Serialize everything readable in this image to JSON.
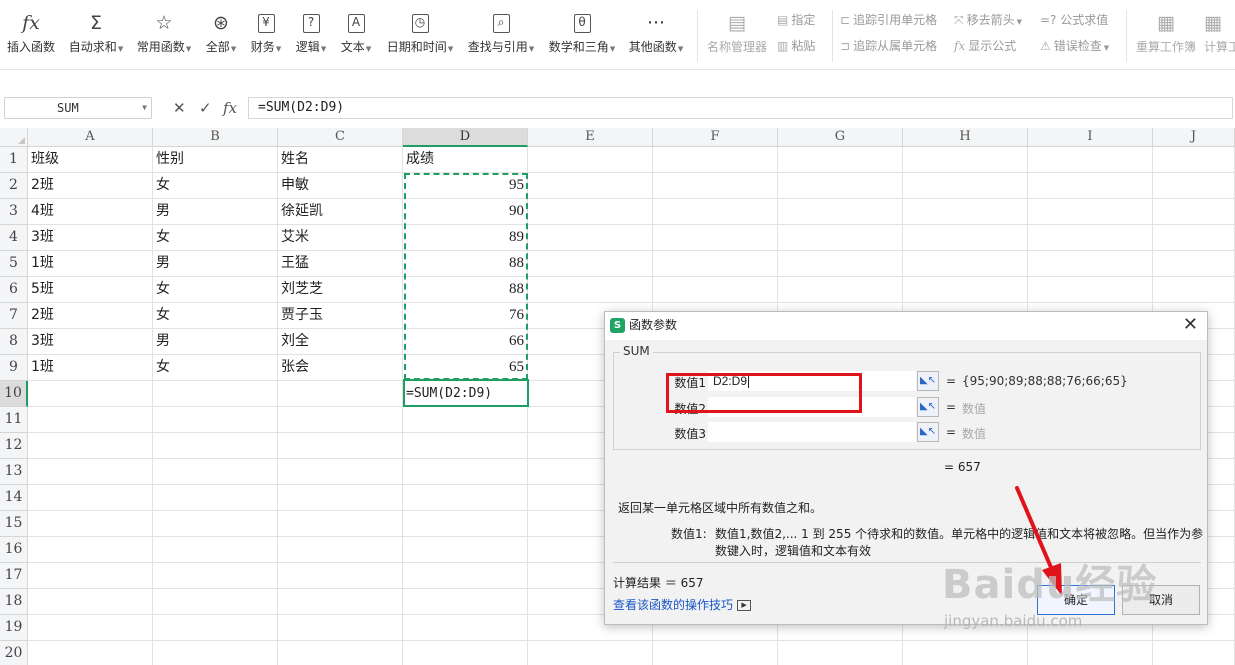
{
  "ribbon": {
    "items": [
      {
        "icon": "fx-icon",
        "glyph": "fx",
        "label": "插入函数",
        "dropdown": false
      },
      {
        "icon": "sigma-icon",
        "glyph": "Σ",
        "label": "自动求和",
        "dropdown": true
      },
      {
        "icon": "star-icon",
        "glyph": "☆",
        "label": "常用函数",
        "dropdown": true
      },
      {
        "icon": "asterisk-icon",
        "glyph": "⊛",
        "label": "全部",
        "dropdown": true
      },
      {
        "icon": "yen-icon",
        "glyph": "¥",
        "label": "财务",
        "dropdown": true
      },
      {
        "icon": "question-icon",
        "glyph": "?",
        "label": "逻辑",
        "dropdown": true
      },
      {
        "icon": "text-icon",
        "glyph": "A",
        "label": "文本",
        "dropdown": true
      },
      {
        "icon": "clock-icon",
        "glyph": "◷",
        "label": "日期和时间",
        "dropdown": true
      },
      {
        "icon": "lookup-icon",
        "glyph": "⌕",
        "label": "查找与引用",
        "dropdown": true
      },
      {
        "icon": "math-icon",
        "glyph": "θ",
        "label": "数学和三角",
        "dropdown": true
      },
      {
        "icon": "more-icon",
        "glyph": "···",
        "label": "其他函数",
        "dropdown": true
      },
      {
        "icon": "name-manager-icon",
        "glyph": "▤",
        "label": "名称管理器",
        "dropdown": false
      },
      {
        "icon": "recalc-workbook-icon",
        "glyph": "▦",
        "label": "重算工作簿",
        "dropdown": false
      },
      {
        "icon": "calc-sheet-icon",
        "glyph": "▦",
        "label": "计算工",
        "dropdown": false
      }
    ],
    "small": {
      "specify": "指定",
      "paste": "粘贴",
      "trace_precedents": "追踪引用单元格",
      "trace_dependents": "追踪从属单元格",
      "remove_arrows": "移去箭头",
      "show_formulas": "显示公式",
      "formula_eval": "=? 公式求值",
      "error_check": "错误检查"
    }
  },
  "formula_bar": {
    "name_box": "SUM",
    "cancel_glyph": "✕",
    "confirm_glyph": "✓",
    "fx_glyph": "fx",
    "content": "=SUM(D2:D9)"
  },
  "grid": {
    "columns": [
      "A",
      "B",
      "C",
      "D",
      "E",
      "F",
      "G",
      "H",
      "I",
      "J"
    ],
    "rows": [
      "1",
      "2",
      "3",
      "4",
      "5",
      "6",
      "7",
      "8",
      "9",
      "10",
      "11",
      "12",
      "13",
      "14",
      "15",
      "16",
      "17",
      "18",
      "19",
      "20"
    ],
    "data": [
      [
        "班级",
        "性别",
        "姓名",
        "成绩"
      ],
      [
        "2班",
        "女",
        "申敏",
        "95"
      ],
      [
        "4班",
        "男",
        "徐延凯",
        "90"
      ],
      [
        "3班",
        "女",
        "艾米",
        "89"
      ],
      [
        "1班",
        "男",
        "王猛",
        "88"
      ],
      [
        "5班",
        "女",
        "刘芝芝",
        "88"
      ],
      [
        "2班",
        "女",
        "贾子玉",
        "76"
      ],
      [
        "3班",
        "男",
        "刘全",
        "66"
      ],
      [
        "1班",
        "女",
        "张会",
        "65"
      ],
      [
        "",
        "",
        "",
        "=SUM(D2:D9)"
      ]
    ]
  },
  "dialog": {
    "title": "函数参数",
    "icon_letter": "S",
    "close_glyph": "✕",
    "function_name": "SUM",
    "args": [
      {
        "label": "数值1",
        "value": "D2:D9",
        "result": "{95;90;89;88;88;76;66;65}"
      },
      {
        "label": "数值2",
        "value": "",
        "result": "数值"
      },
      {
        "label": "数值3",
        "value": "",
        "result": "数值"
      }
    ],
    "eq": "=",
    "total": "= 657",
    "description": "返回某一单元格区域中所有数值之和。",
    "help_label": "数值1:",
    "help_line1": "数值1,数值2,... 1 到 255 个待求和的数值。单元格中的逻辑值和文本将被忽略。但当作为参",
    "help_line2": "数键入时，逻辑值和文本有效",
    "result": "计算结果 ＝ 657",
    "link": "查看该函数的操作技巧",
    "ok": "确定",
    "cancel": "取消"
  },
  "watermark": {
    "main": "Baidu经验",
    "sub": "jingyan.baidu.com"
  },
  "colors": {
    "accent_green": "#1e9e60",
    "highlight_red": "#e0131a",
    "link_blue": "#1a56c8"
  }
}
